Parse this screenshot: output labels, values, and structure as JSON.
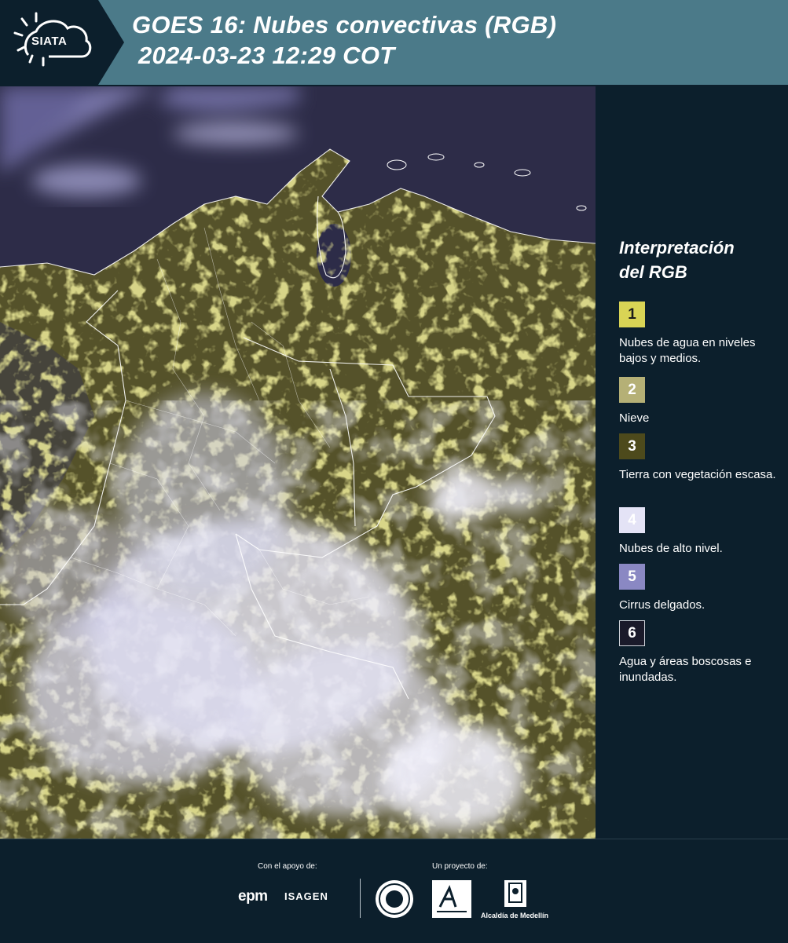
{
  "header": {
    "logo_text": "SIATA",
    "title_line1": "GOES 16: Nubes convectivas (RGB)",
    "title_line2": "2024-03-23 12:29 COT"
  },
  "legend": {
    "title_line1": "Interpretación",
    "title_line2": "del RGB",
    "items": [
      {
        "number": "1",
        "label": "Nubes de agua en niveles bajos y medios.",
        "color": "#d9d455"
      },
      {
        "number": "2",
        "label": "Nieve",
        "color": "#b5b076"
      },
      {
        "number": "3",
        "label": "Tierra con vegetación escasa.",
        "color": "#4d4a1c"
      },
      {
        "number": "4",
        "label": "Nubes de alto nivel.",
        "color": "#e4e3f6"
      },
      {
        "number": "5",
        "label": "Cirrus delgados.",
        "color": "#8a88c3"
      },
      {
        "number": "6",
        "label": "Agua y áreas boscosas e inundadas.",
        "color": "#1a1a2a"
      }
    ]
  },
  "footer": {
    "support_label": "Con el apoyo de:",
    "project_label": "Un proyecto de:",
    "sponsor1": "epm",
    "sponsor2": "ISAGEN",
    "partner_text": "Alcaldía de Medellín"
  },
  "colors": {
    "header_bg": "#4b7a89",
    "page_bg": "#0c1f2c",
    "ocean": "#2f2e48",
    "land": "#545126",
    "cloud_high": "#e6e5f5",
    "cloud_low": "#d9d455"
  },
  "icons": [
    "siata-sun-cloud-icon"
  ]
}
